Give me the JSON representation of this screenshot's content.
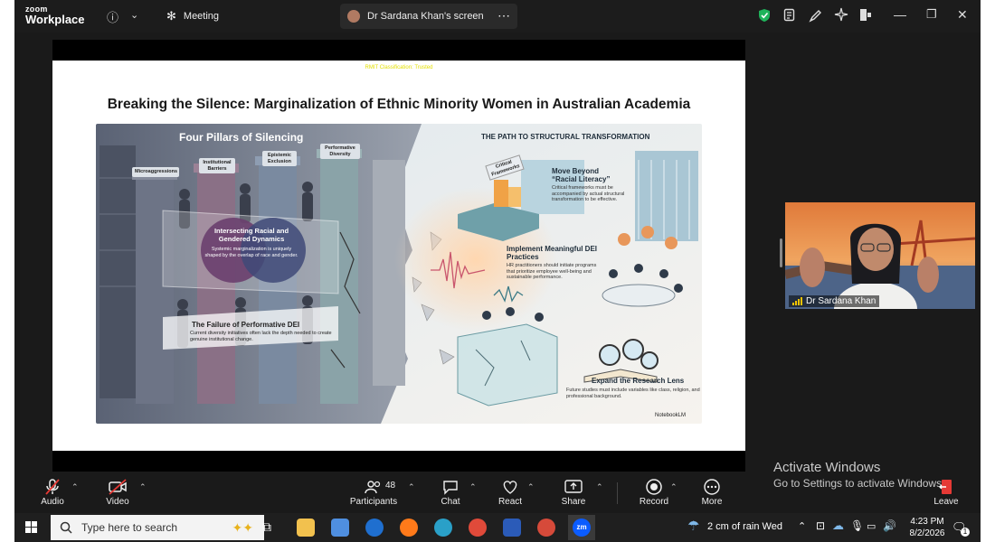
{
  "app": {
    "logo_line1": "zoom",
    "logo_line2": "Workplace"
  },
  "titlebar": {
    "meeting_tab": "Meeting",
    "screen_tab": "Dr Sardana Khan's screen",
    "more_glyph": "⋯"
  },
  "slide": {
    "classification": "RMIT Classification: Trusted",
    "title": "Breaking the Silence: Marginalization of Ethnic Minority Women in Australian Academia",
    "left_header": "Four Pillars of Silencing",
    "right_header": "THE PATH TO STRUCTURAL TRANSFORMATION",
    "pillars": [
      "Microaggressions",
      "Institutional Barriers",
      "Epistemic Exclusion",
      "Performative Diversity"
    ],
    "venn_title": "Intersecting Racial and Gendered Dynamics",
    "venn_text": "Systemic marginalization is uniquely shaped by the overlap of race and gender.",
    "failure_title": "The Failure of Performative DEI",
    "failure_text": "Current diversity initiatives often lack the depth needed to create genuine institutional change.",
    "critical_label": "Critical Frameworks",
    "move_title": "Move Beyond “Racial Literacy”",
    "move_text": "Critical frameworks must be accompanied by actual structural transformation to be effective.",
    "dei_title": "Implement Meaningful DEI Practices",
    "dei_text": "HR practitioners should initiate programs that prioritize employee well-being and sustainable performance.",
    "lens_title": "Expand the Research Lens",
    "lens_text": "Future studies must include variables like class, religion, and professional background.",
    "watermark": "NotebookLM"
  },
  "video": {
    "participant_name": "Dr Sardana Khan"
  },
  "activate_windows": {
    "title": "Activate Windows",
    "subtitle": "Go to Settings to activate Windows."
  },
  "toolbar": {
    "audio": "Audio",
    "video": "Video",
    "participants": "Participants",
    "participants_count": "48",
    "chat": "Chat",
    "react": "React",
    "share": "Share",
    "record": "Record",
    "more": "More",
    "leave": "Leave"
  },
  "taskbar": {
    "search_placeholder": "Type here to search",
    "weather": "2 cm of rain Wed",
    "time": "4:23 PM",
    "date": "8/2/2026",
    "notification_count": "1"
  },
  "colors": {
    "accent_green": "#1fb35a",
    "leave_red": "#e53935",
    "zoom_blue": "#0b5cff"
  }
}
